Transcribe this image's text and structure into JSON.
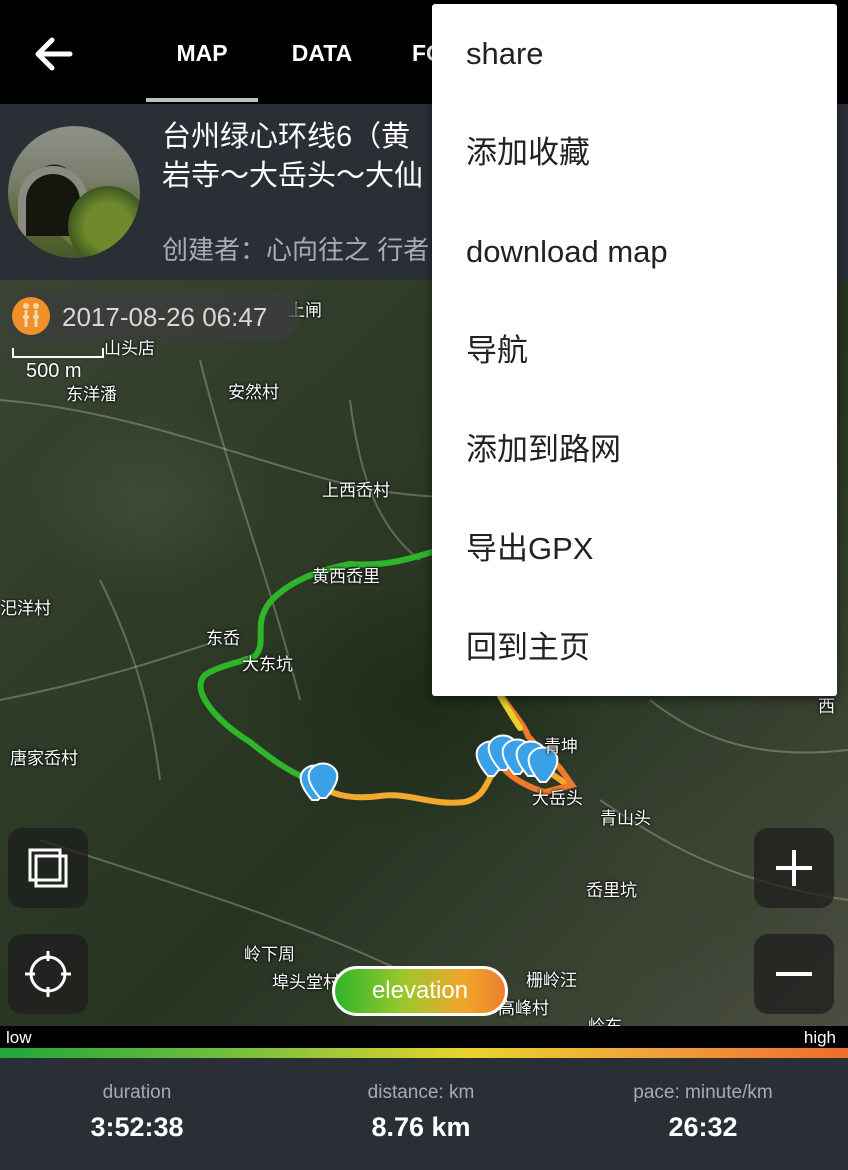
{
  "header": {
    "tabs": [
      {
        "label": "MAP"
      },
      {
        "label": "DATA"
      },
      {
        "label": "FO"
      }
    ]
  },
  "info": {
    "title_line1": "台州绿心环线6（黄",
    "title_line2": "岩寺～大岳头～大仙",
    "creator": "创建者：心向往之 行者"
  },
  "map": {
    "date": "2017-08-26 06:47",
    "scale": "500 m",
    "places": [
      {
        "id": "shangchuang",
        "name": "上闸"
      },
      {
        "id": "shantoudian",
        "name": "山头店"
      },
      {
        "id": "dongyangpan",
        "name": "东洋潘"
      },
      {
        "id": "anrancun",
        "name": "安然村"
      },
      {
        "id": "shangxixiangcun",
        "name": "上西岙村"
      },
      {
        "id": "huangxiyuan",
        "name": "黄西岙里"
      },
      {
        "id": "yangcun",
        "name": "汜洋村"
      },
      {
        "id": "dongao",
        "name": "东岙"
      },
      {
        "id": "dadongkeng",
        "name": "大东坑"
      },
      {
        "id": "tangjiaaocun",
        "name": "唐家岙村"
      },
      {
        "id": "qingkun",
        "name": "青坤"
      },
      {
        "id": "dayuetou",
        "name": "大岳头"
      },
      {
        "id": "qingshantou",
        "name": "青山头"
      },
      {
        "id": "aolikeng",
        "name": "岙里坑"
      },
      {
        "id": "lingxiazhou",
        "name": "岭下周"
      },
      {
        "id": "butoutang",
        "name": "埠头堂村"
      },
      {
        "id": "zhalingwang",
        "name": "栅岭汪"
      },
      {
        "id": "gaofengcun",
        "name": "高峰村"
      },
      {
        "id": "lingdong",
        "name": "岭东"
      },
      {
        "id": "xi",
        "name": "西"
      }
    ],
    "elevation_label": "elevation"
  },
  "legend": {
    "low": "low",
    "high": "high"
  },
  "stats": {
    "duration_label": "duration",
    "duration_value": "3:52:38",
    "distance_label": "distance: km",
    "distance_value": "8.76 km",
    "pace_label": "pace: minute/km",
    "pace_value": "26:32"
  },
  "menu": {
    "items": [
      {
        "label": "share"
      },
      {
        "label": "添加收藏"
      },
      {
        "label": "download map"
      },
      {
        "label": "导航"
      },
      {
        "label": "添加到路网"
      },
      {
        "label": "导出GPX"
      },
      {
        "label": "回到主页"
      }
    ]
  },
  "colors": {
    "low": "#1fa63a",
    "high": "#ef6b2c",
    "panel": "#2a2f36",
    "marker": "#3aa0e8"
  },
  "icons": [
    "back-arrow-icon",
    "layers-icon",
    "locate-icon",
    "zoom-in-icon",
    "zoom-out-icon",
    "hiker-icon",
    "pin-icon"
  ]
}
